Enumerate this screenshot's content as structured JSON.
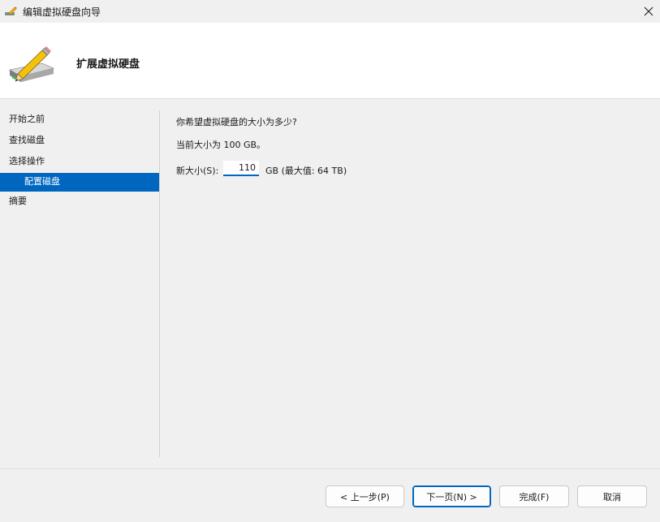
{
  "window": {
    "title": "编辑虚拟硬盘向导",
    "icon": "pencil-disk-icon"
  },
  "header": {
    "title": "扩展虚拟硬盘",
    "icon": "disk-pencil-icon"
  },
  "nav": {
    "items": [
      {
        "label": "开始之前"
      },
      {
        "label": "查找磁盘"
      },
      {
        "label": "选择操作"
      },
      {
        "label": "配置磁盘"
      },
      {
        "label": "摘要"
      }
    ],
    "active_index": 3
  },
  "main": {
    "question": "你希望虚拟硬盘的大小为多少?",
    "current_size_text": "当前大小为 100 GB。",
    "new_size_label": "新大小(S):",
    "new_size_value": "110",
    "unit_text": "GB (最大值: 64 TB)"
  },
  "buttons": {
    "back": "< 上一步(P)",
    "next": "下一页(N) >",
    "finish": "完成(F)",
    "cancel": "取消"
  },
  "colors": {
    "accent": "#0067c0",
    "background": "#f0f0f0",
    "header_background": "#ffffff"
  }
}
